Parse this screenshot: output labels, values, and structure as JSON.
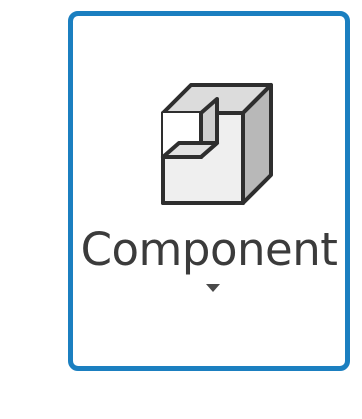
{
  "ribbon_button": {
    "label": "Component",
    "icon": "component-block-icon",
    "dropdown_icon": "dropdown-arrow-icon",
    "highlight_color": "#1b7fc0"
  }
}
